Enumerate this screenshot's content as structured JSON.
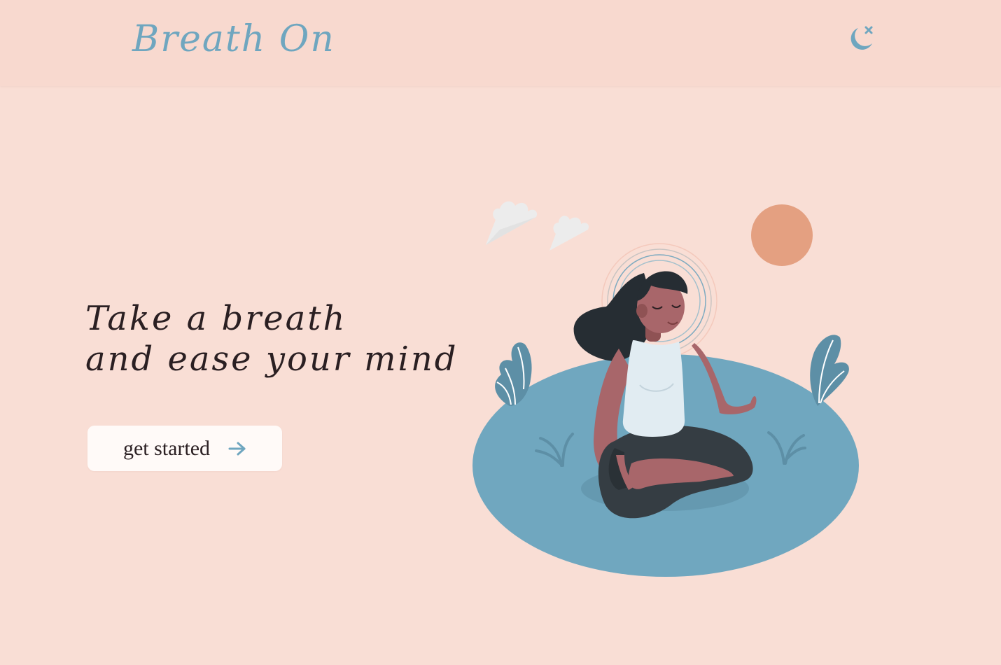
{
  "header": {
    "logo": "Breath On",
    "theme_toggle_icon": "moon-star-icon"
  },
  "hero": {
    "title_line1": "Take a breath",
    "title_line2": "and ease your mind",
    "cta_label": "get started",
    "cta_icon": "arrow-right-icon"
  },
  "illustration": {
    "subject": "woman-meditating-illustration"
  },
  "colors": {
    "background": "#f9ded5",
    "header_bg": "#f8d9cf",
    "accent_blue": "#6fa6bf",
    "sun": "#e4a081",
    "text_dark": "#2a1f22",
    "button_bg": "#fffaf8"
  }
}
